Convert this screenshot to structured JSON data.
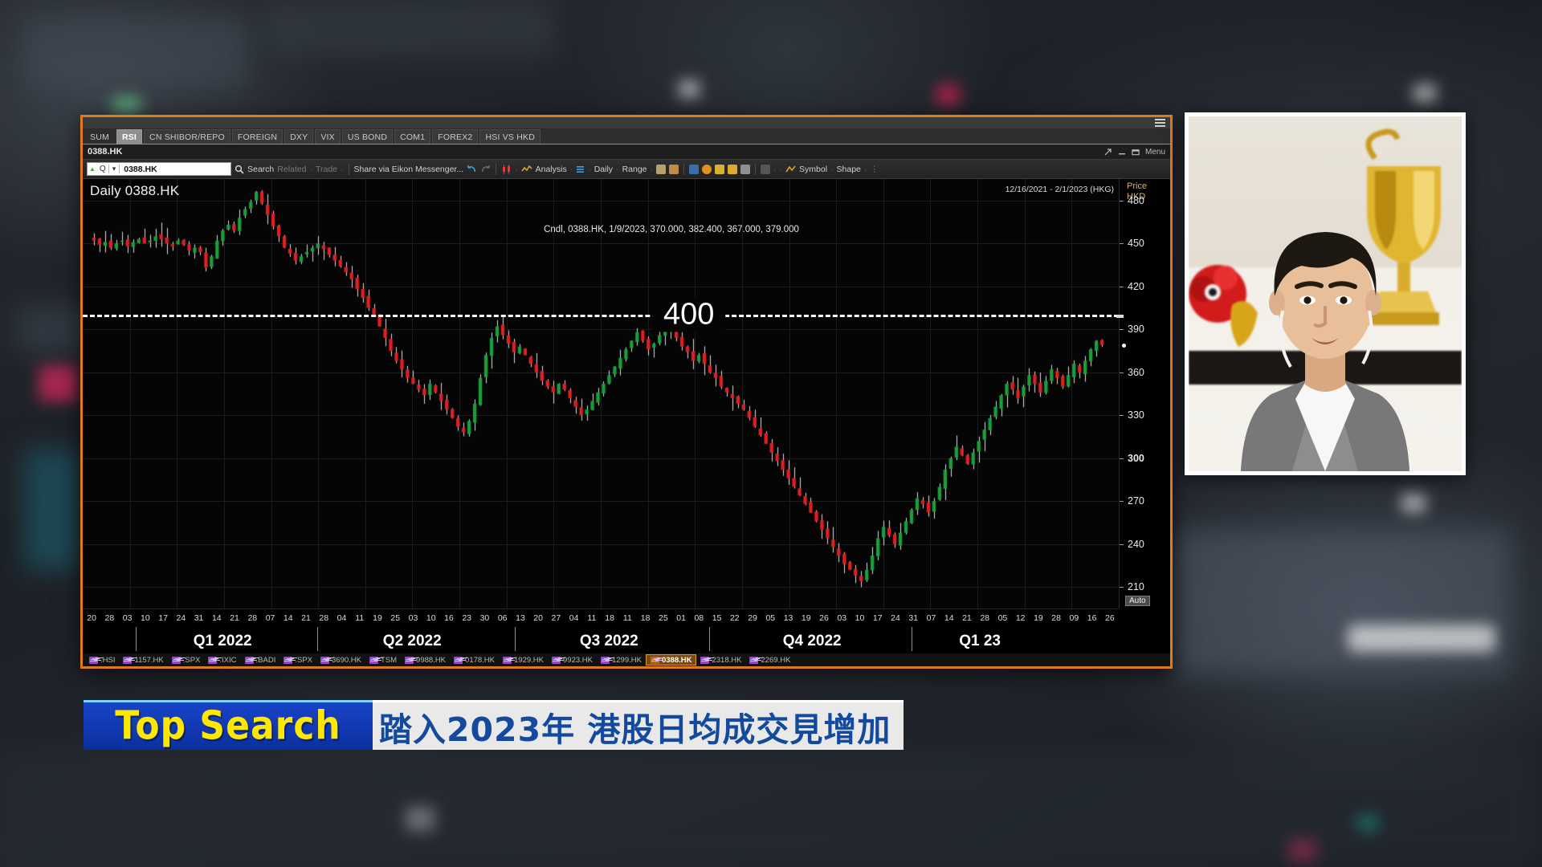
{
  "app": {
    "window_title": "0388.HK",
    "menu_label": "Menu",
    "hamburger_icon": "hamburger-menu-icon"
  },
  "tabs": [
    {
      "label": "SUM",
      "active": false,
      "plain": true
    },
    {
      "label": "RSI",
      "active": true,
      "plain": false
    },
    {
      "label": "CN SHIBOR/REPO",
      "active": false,
      "plain": false
    },
    {
      "label": "FOREIGN",
      "active": false,
      "plain": false
    },
    {
      "label": "DXY",
      "active": false,
      "plain": false
    },
    {
      "label": "VIX",
      "active": false,
      "plain": false
    },
    {
      "label": "US BOND",
      "active": false,
      "plain": false
    },
    {
      "label": "COM1",
      "active": false,
      "plain": false
    },
    {
      "label": "FOREX2",
      "active": false,
      "plain": false
    },
    {
      "label": "HSI VS HKD",
      "active": false,
      "plain": false
    }
  ],
  "toolbar": {
    "search_value": "0388.HK",
    "search_placeholder": "Search",
    "search_label": "Search",
    "related_label": "Related",
    "trade_label": "Trade",
    "share_label": "Share via Eikon Messenger...",
    "analysis_label": "Analysis",
    "interval_label": "Daily",
    "range_label": "Range",
    "symbol_label": "Symbol",
    "shape_label": "Shape",
    "search_icon": "magnifier-icon",
    "undo_icon": "undo-arrow-icon",
    "redo_icon": "redo-arrow-icon",
    "quote_icon": "quote-bars-icon",
    "caret_icon": "up-caret-icon",
    "dropdown_icon": "chevron-down-icon"
  },
  "chart_data": {
    "type": "candlestick",
    "title": "Daily 0388.HK",
    "instrument": "0388.HK",
    "interval": "Daily",
    "date_range": "12/16/2021 - 2/1/2023 (HKG)",
    "price_axis_title": "Price",
    "price_axis_unit": "HKD",
    "auto_button": "Auto",
    "tooltip": "Cndl, 0388.HK, 1/9/2023, 370.000, 382.400, 367.000, 379.000",
    "last_candle": {
      "label": "Cndl",
      "ric": "0388.HK",
      "date": "1/9/2023",
      "open": 370.0,
      "high": 382.4,
      "low": 367.0,
      "close": 379.0
    },
    "ylim": [
      195,
      495
    ],
    "yticks": [
      480,
      450,
      420,
      390,
      360,
      330,
      300,
      270,
      240,
      210
    ],
    "ytick_bold": 300,
    "reference_line": {
      "value": 400,
      "label": "400",
      "style": "dashed",
      "color": "#ffffff"
    },
    "grid": true,
    "up_color": "#1aa03a",
    "down_color": "#e02020",
    "xlabel": "",
    "ylabel": "Price HKD",
    "quarters": [
      {
        "label": "Q1 2022",
        "center_pct": 13.5
      },
      {
        "label": "Q2 2022",
        "center_pct": 31.8
      },
      {
        "label": "Q3 2022",
        "center_pct": 50.8
      },
      {
        "label": "Q4 2022",
        "center_pct": 70.4
      },
      {
        "label": "Q1 23",
        "center_pct": 86.6
      }
    ],
    "quarter_dividers_pct": [
      5.1,
      22.6,
      41.7,
      60.5,
      80.0
    ],
    "xtick_labels": [
      "20",
      "28",
      "03",
      "10",
      "17",
      "24",
      "31",
      "14",
      "21",
      "28",
      "07",
      "14",
      "21",
      "28",
      "04",
      "11",
      "19",
      "25",
      "03",
      "10",
      "16",
      "23",
      "30",
      "06",
      "13",
      "20",
      "27",
      "04",
      "11",
      "18",
      "11",
      "18",
      "25",
      "01",
      "08",
      "15",
      "22",
      "29",
      "05",
      "13",
      "19",
      "26",
      "03",
      "10",
      "17",
      "24",
      "31",
      "07",
      "14",
      "21",
      "28",
      "05",
      "12",
      "19",
      "28",
      "09",
      "16",
      "26"
    ],
    "series": [
      {
        "name": "0388.HK",
        "ohlc_close_path": [
          452,
          449,
          451,
          447,
          450,
          452,
          448,
          451,
          453,
          450,
          452,
          455,
          453,
          450,
          448,
          452,
          449,
          445,
          447,
          444,
          433,
          441,
          452,
          459,
          463,
          459,
          468,
          474,
          479,
          486,
          478,
          470,
          462,
          455,
          447,
          443,
          438,
          441,
          444,
          447,
          450,
          446,
          442,
          438,
          434,
          430,
          425,
          418,
          412,
          405,
          400,
          392,
          384,
          375,
          368,
          362,
          356,
          352,
          348,
          344,
          352,
          346,
          340,
          334,
          328,
          322,
          318,
          326,
          338,
          356,
          372,
          384,
          392,
          386,
          380,
          374,
          378,
          372,
          366,
          360,
          354,
          350,
          346,
          352,
          348,
          342,
          336,
          330,
          334,
          340,
          346,
          352,
          358,
          364,
          370,
          376,
          382,
          388,
          382,
          376,
          380,
          386,
          392,
          390,
          384,
          378,
          374,
          368,
          372,
          366,
          360,
          356,
          350,
          346,
          342,
          338,
          334,
          328,
          322,
          316,
          310,
          304,
          298,
          292,
          286,
          280,
          274,
          268,
          262,
          256,
          250,
          244,
          238,
          232,
          226,
          222,
          218,
          214,
          222,
          232,
          244,
          252,
          246,
          240,
          248,
          256,
          264,
          272,
          268,
          262,
          270,
          280,
          292,
          300,
          308,
          302,
          296,
          304,
          312,
          320,
          328,
          336,
          344,
          352,
          348,
          342,
          350,
          358,
          352,
          346,
          354,
          362,
          356,
          350,
          358,
          366,
          360,
          368,
          376,
          382,
          379
        ]
      }
    ]
  },
  "ticker_strip": [
    {
      "label": ".HSI",
      "active": false
    },
    {
      "label": "1157.HK",
      "active": false
    },
    {
      "label": ".SPX",
      "active": false
    },
    {
      "label": ".IXIC",
      "active": false
    },
    {
      "label": ".BADI",
      "active": false
    },
    {
      "label": ".SPX",
      "active": false
    },
    {
      "label": "3690.HK",
      "active": false
    },
    {
      "label": "TSM",
      "active": false
    },
    {
      "label": "9988.HK",
      "active": false
    },
    {
      "label": "0178.HK",
      "active": false
    },
    {
      "label": "1929.HK",
      "active": false
    },
    {
      "label": "9923.HK",
      "active": false
    },
    {
      "label": "1299.HK",
      "active": false
    },
    {
      "label": "0388.HK",
      "active": true
    },
    {
      "label": "2318.HK",
      "active": false
    },
    {
      "label": "2269.HK",
      "active": false
    }
  ],
  "video": {
    "caption": "live-guest-video-feed"
  },
  "banner": {
    "badge": "Top Search",
    "headline": "踏入2023年 港股日均成交見增加",
    "badge_bg": "#1944c8",
    "badge_text_color": "#ffe800",
    "headline_bg": "#e9e9e9",
    "headline_text_color": "#134a9e"
  }
}
